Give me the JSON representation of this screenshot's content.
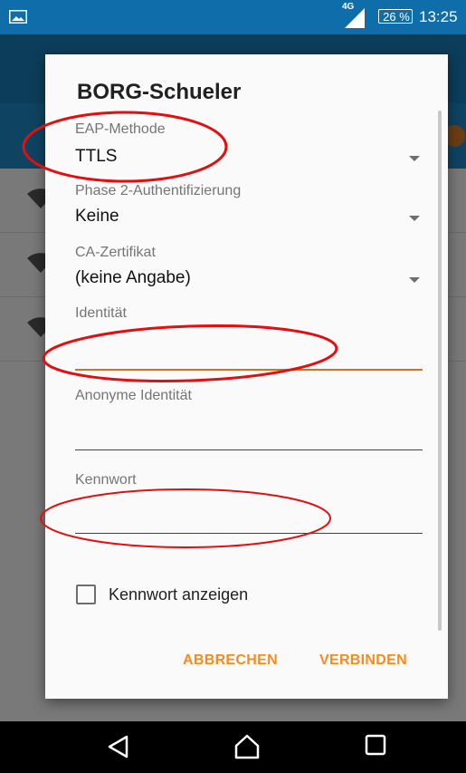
{
  "status_bar": {
    "network": "4G",
    "battery": "26 %",
    "time": "13:25"
  },
  "dialog": {
    "title": "BORG-Schueler",
    "fields": {
      "eap_method": {
        "label": "EAP-Methode",
        "value": "TTLS"
      },
      "phase2": {
        "label": "Phase 2-Authentifizierung",
        "value": "Keine"
      },
      "ca_cert": {
        "label": "CA-Zertifikat",
        "value": "(keine Angabe)"
      },
      "identity": {
        "label": "Identität",
        "value": ""
      },
      "anonymous_identity": {
        "label": "Anonyme Identität",
        "value": ""
      },
      "password": {
        "label": "Kennwort",
        "value": ""
      }
    },
    "show_password": {
      "label": "Kennwort anzeigen",
      "checked": false
    },
    "buttons": {
      "cancel": "ABBRECHEN",
      "connect": "VERBINDEN"
    }
  },
  "colors": {
    "accent": "#f48c1e",
    "status_bar": "#0f6eaa",
    "annotation": "#e01010"
  },
  "icons": [
    "gallery-icon",
    "signal-icon",
    "battery-icon",
    "wifi-icon",
    "dropdown-caret-icon",
    "back-icon",
    "home-icon",
    "recents-icon"
  ]
}
